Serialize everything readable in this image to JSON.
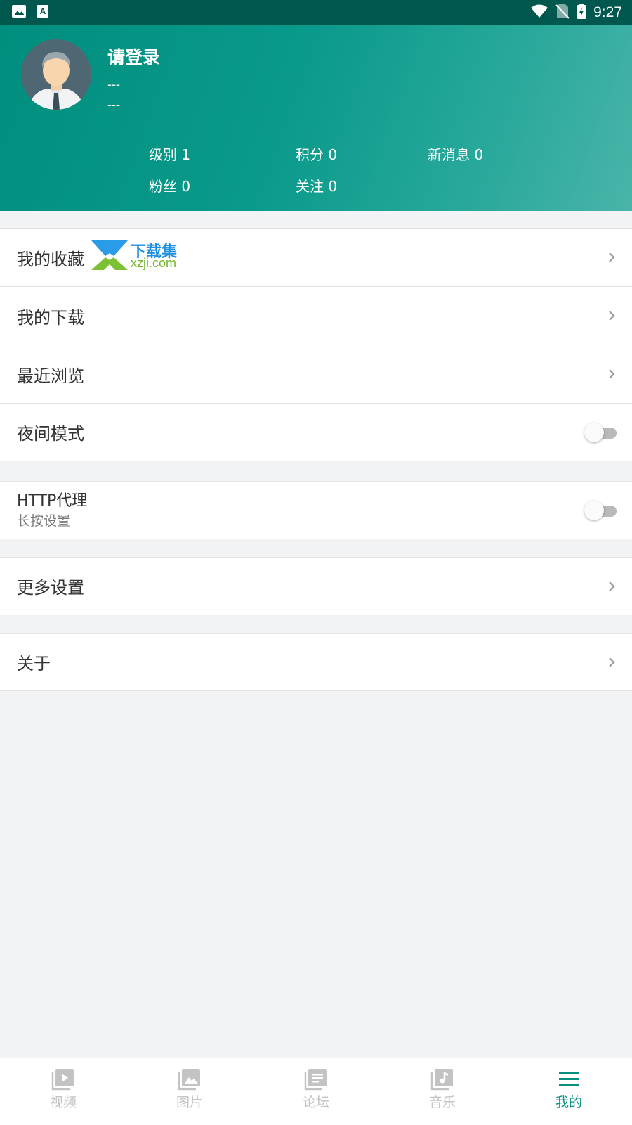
{
  "status_bar": {
    "time": "9:27",
    "left_icons": [
      "image-icon",
      "a-font-icon"
    ],
    "right_icons": [
      "wifi-icon",
      "no-sim-icon",
      "battery-charging-icon"
    ]
  },
  "profile": {
    "title": "请登录",
    "line1": "---",
    "line2": "---",
    "stats": {
      "level": "级别 1",
      "points": "积分 0",
      "messages": "新消息 0",
      "fans": "粉丝 0",
      "following": "关注 0"
    }
  },
  "watermark": {
    "cn": "下载集",
    "en": "xzji.com"
  },
  "menu": {
    "favorites": "我的收藏",
    "downloads": "我的下载",
    "recent": "最近浏览",
    "night_mode": "夜间模式",
    "http_proxy": "HTTP代理",
    "http_proxy_hint": "长按设置",
    "more_settings": "更多设置",
    "about": "关于"
  },
  "toggles": {
    "night_mode_on": false,
    "http_proxy_on": false
  },
  "bottom_nav": {
    "items": [
      {
        "label": "视频",
        "icon": "video-icon",
        "active": false
      },
      {
        "label": "图片",
        "icon": "images-icon",
        "active": false
      },
      {
        "label": "论坛",
        "icon": "forum-icon",
        "active": false
      },
      {
        "label": "音乐",
        "icon": "music-icon",
        "active": false
      },
      {
        "label": "我的",
        "icon": "menu-icon",
        "active": true
      }
    ]
  },
  "colors": {
    "accent": "#0b8f80",
    "header_start": "#008f7e",
    "header_end": "#4ab4aa",
    "status_bar": "#00574e"
  }
}
